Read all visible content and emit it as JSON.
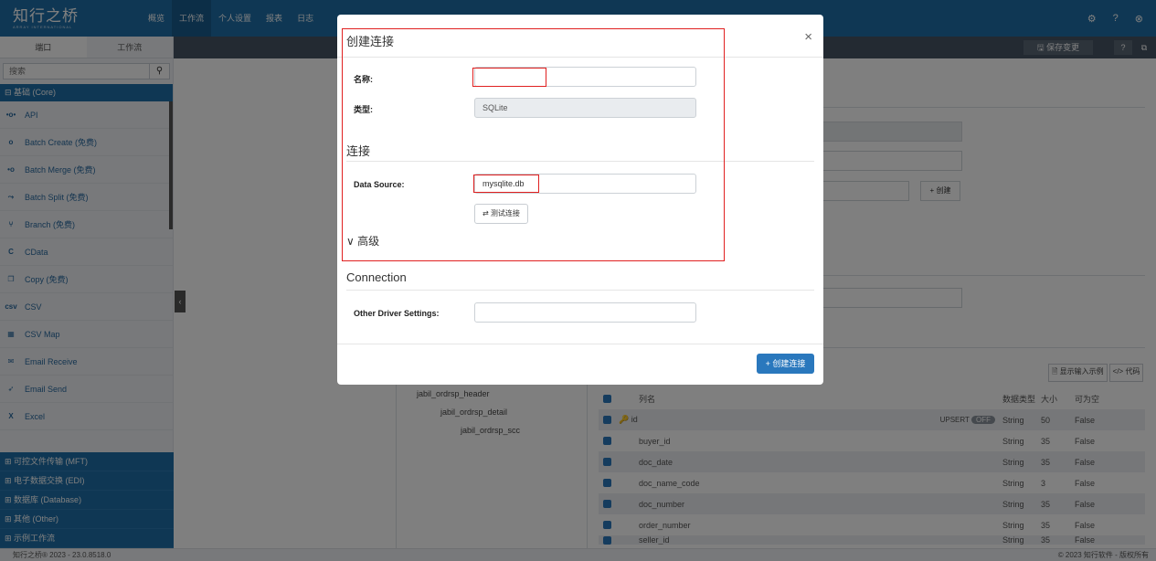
{
  "header": {
    "logo": "知行之桥",
    "logo_sub": "ARRAY INTERNATIONAL",
    "nav": [
      "概览",
      "工作流",
      "个人设置",
      "报表",
      "日志"
    ],
    "active_nav": 1
  },
  "sidebar": {
    "tabs": [
      "端口",
      "工作流"
    ],
    "search_placeholder": "搜索",
    "category_top": "⊟ 基础 (Core)",
    "connectors": [
      {
        "icon": "api-icon",
        "glyph": "•o•",
        "label": "API"
      },
      {
        "icon": "batch-create-icon",
        "glyph": "o",
        "label": "Batch Create (免费)"
      },
      {
        "icon": "batch-merge-icon",
        "glyph": "•o",
        "label": "Batch Merge (免费)"
      },
      {
        "icon": "batch-split-icon",
        "glyph": "⤳",
        "label": "Batch Split (免费)"
      },
      {
        "icon": "branch-icon",
        "glyph": "⑂",
        "label": "Branch (免费)"
      },
      {
        "icon": "cdata-icon",
        "glyph": "C",
        "label": "CData"
      },
      {
        "icon": "copy-icon",
        "glyph": "❐",
        "label": "Copy (免费)"
      },
      {
        "icon": "csv-icon",
        "glyph": "csv",
        "label": "CSV"
      },
      {
        "icon": "csv-map-icon",
        "glyph": "▦",
        "label": "CSV Map"
      },
      {
        "icon": "email-receive-icon",
        "glyph": "✉",
        "label": "Email Receive"
      },
      {
        "icon": "email-send-icon",
        "glyph": "➶",
        "label": "Email Send"
      },
      {
        "icon": "excel-icon",
        "glyph": "X",
        "label": "Excel"
      }
    ],
    "categories": [
      "⊞ 可控文件传输 (MFT)",
      "⊞ 电子数据交换 (EDI)",
      "⊞ 数据库 (Database)",
      "⊞ 其他 (Other)",
      "⊞ 示例工作流"
    ]
  },
  "toolbar": {
    "save_label": "🖫 保存变更"
  },
  "background": {
    "create_small": "+ 创建",
    "show_sample": "🗎 显示输入示例",
    "code": "</> 代码",
    "tree": [
      "jabil_ordrsp_header",
      "jabil_ordrsp_detail",
      "jabil_ordrsp_scc"
    ],
    "grid_headers": [
      "列名",
      "数据类型",
      "大小",
      "可为空"
    ],
    "upsert_label": "UPSERT",
    "upsert_toggle": "OFF",
    "rows": [
      {
        "name": "id",
        "type": "String",
        "size": "50",
        "nullable": "False"
      },
      {
        "name": "buyer_id",
        "type": "String",
        "size": "35",
        "nullable": "False"
      },
      {
        "name": "doc_date",
        "type": "String",
        "size": "35",
        "nullable": "False"
      },
      {
        "name": "doc_name_code",
        "type": "String",
        "size": "3",
        "nullable": "False"
      },
      {
        "name": "doc_number",
        "type": "String",
        "size": "35",
        "nullable": "False"
      },
      {
        "name": "order_number",
        "type": "String",
        "size": "35",
        "nullable": "False"
      },
      {
        "name": "seller_id",
        "type": "String",
        "size": "35",
        "nullable": "False"
      }
    ]
  },
  "modal": {
    "title": "创建连接",
    "name_label": "名称:",
    "name_value": "",
    "type_label": "类型:",
    "type_value": "SQLite",
    "section_connect": "连接",
    "datasource_label": "Data Source:",
    "datasource_value": "mysqlite.db",
    "test_label": "⇄ 测试连接",
    "advanced_label": "∨ 高级",
    "section_connection": "Connection",
    "other_label": "Other Driver Settings:",
    "other_value": "",
    "create_label": "+ 创建连接"
  },
  "footer": {
    "left": "知行之桥® 2023 - 23.0.8518.0",
    "right": "© 2023 知行软件 - 版权所有"
  }
}
